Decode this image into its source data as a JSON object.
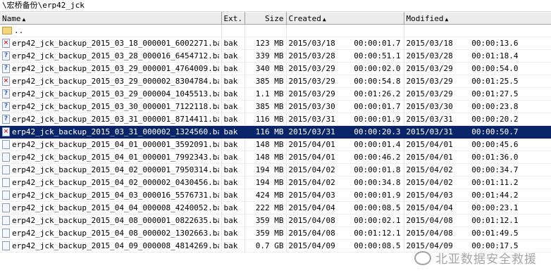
{
  "path": "\\宏桥备份\\erp42_jck",
  "columns": {
    "name": "Name",
    "ext": "Ext.",
    "size": "Size",
    "created": "Created",
    "modified": "Modified"
  },
  "parent": {
    "name": ".."
  },
  "files": [
    {
      "name": "erp42_jck_backup_2015_03_18_000001_6002271.bak",
      "ext": "bak",
      "size": "123 MB",
      "created": "2015/03/18    00:00:01.7",
      "modified": "2015/03/18    00:00:13.6",
      "icon": "error"
    },
    {
      "name": "erp42_jck_backup_2015_03_28_000016_6454712.bak",
      "ext": "bak",
      "size": "339 MB",
      "created": "2015/03/28    00:00:51.1",
      "modified": "2015/03/28    00:01:18.4",
      "icon": "unknown"
    },
    {
      "name": "erp42_jck_backup_2015_03_29_000001_4764009.bak",
      "ext": "bak",
      "size": "340 MB",
      "created": "2015/03/29    00:00:02.0",
      "modified": "2015/03/29    00:00:54.0",
      "icon": "unknown"
    },
    {
      "name": "erp42_jck_backup_2015_03_29_000002_8304784.bak",
      "ext": "bak",
      "size": "385 MB",
      "created": "2015/03/29    00:00:54.8",
      "modified": "2015/03/29    00:01:25.5",
      "icon": "error"
    },
    {
      "name": "erp42_jck_backup_2015_03_29_000004_1045513.bak",
      "ext": "bak",
      "size": "1.1 MB",
      "created": "2015/03/29    00:01:26.2",
      "modified": "2015/03/29    00:01:27.5",
      "icon": "unknown"
    },
    {
      "name": "erp42_jck_backup_2015_03_30_000001_7122118.bak",
      "ext": "bak",
      "size": "385 MB",
      "created": "2015/03/30    00:00:01.7",
      "modified": "2015/03/30    00:00:23.8",
      "icon": "unknown"
    },
    {
      "name": "erp42_jck_backup_2015_03_31_000001_8714411.bak",
      "ext": "bak",
      "size": "116 MB",
      "created": "2015/03/31    00:00:01.9",
      "modified": "2015/03/31    00:00:20.2",
      "icon": "unknown"
    },
    {
      "name": "erp42_jck_backup_2015_03_31_000002_1324560.bak",
      "ext": "bak",
      "size": "116 MB",
      "created": "2015/03/31    00:00:20.3",
      "modified": "2015/03/31    00:00:50.7",
      "icon": "error",
      "selected": true
    },
    {
      "name": "erp42_jck_backup_2015_04_01_000001_3592091.bak",
      "ext": "bak",
      "size": "148 MB",
      "created": "2015/04/01    00:00:01.4",
      "modified": "2015/04/01    00:00:45.6",
      "icon": "file"
    },
    {
      "name": "erp42_jck_backup_2015_04_01_000001_7992343.bak",
      "ext": "bak",
      "size": "148 MB",
      "created": "2015/04/01    00:00:46.2",
      "modified": "2015/04/01    00:01:36.0",
      "icon": "file"
    },
    {
      "name": "erp42_jck_backup_2015_04_02_000001_7950314.bak",
      "ext": "bak",
      "size": "194 MB",
      "created": "2015/04/02    00:00:01.8",
      "modified": "2015/04/02    00:00:34.7",
      "icon": "file"
    },
    {
      "name": "erp42_jck_backup_2015_04_02_000002_0430456.bak",
      "ext": "bak",
      "size": "194 MB",
      "created": "2015/04/02    00:00:34.8",
      "modified": "2015/04/02    00:01:11.2",
      "icon": "file"
    },
    {
      "name": "erp42_jck_backup_2015_04_03_000016_5576731.bak",
      "ext": "bak",
      "size": "424 MB",
      "created": "2015/04/03    00:00:01.9",
      "modified": "2015/04/03    00:01:44.2",
      "icon": "file"
    },
    {
      "name": "erp42_jck_backup_2015_04_04_000008_4240052.bak",
      "ext": "bak",
      "size": "222 MB",
      "created": "2015/04/04    00:00:08.5",
      "modified": "2015/04/04    00:00:23.1",
      "icon": "file"
    },
    {
      "name": "erp42_jck_backup_2015_04_08_000001_0822635.bak",
      "ext": "bak",
      "size": "359 MB",
      "created": "2015/04/08    00:00:02.1",
      "modified": "2015/04/08    00:01:12.1",
      "icon": "file"
    },
    {
      "name": "erp42_jck_backup_2015_04_08_000002_1302663.bak",
      "ext": "bak",
      "size": "359 MB",
      "created": "2015/04/08    00:01:12.1",
      "modified": "2015/04/08    00:01:49.5",
      "icon": "file"
    },
    {
      "name": "erp42_jck_backup_2015_04_09_000008_4814269.bak",
      "ext": "bak",
      "size": "0.7 GB",
      "created": "2015/04/09    00:00:08.5",
      "modified": "2015/04/09    00:00:17.5",
      "icon": "file"
    }
  ],
  "watermark": "北亚数据安全救援",
  "colors": {
    "selection": "#0a246a",
    "error_icon": "#d22020",
    "unknown_icon": "#2a5bd7",
    "header_bg": "#ececec"
  }
}
